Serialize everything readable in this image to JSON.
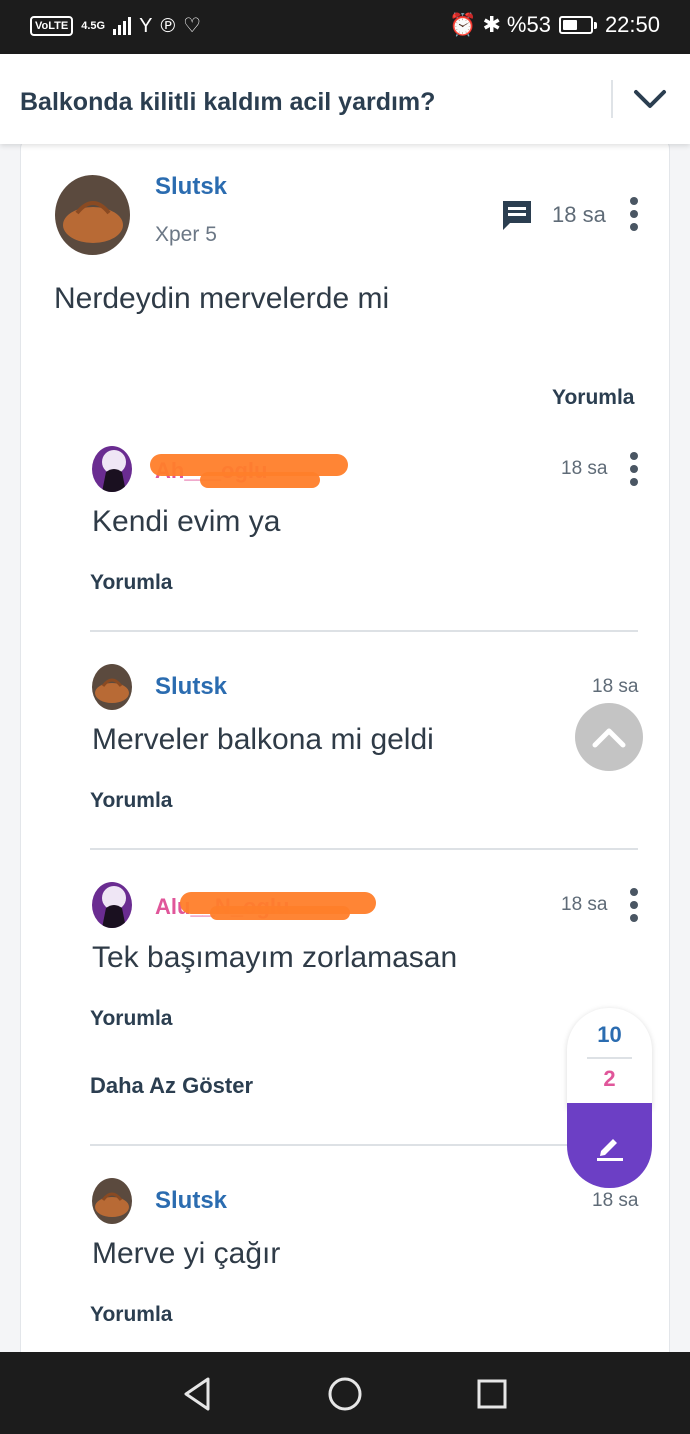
{
  "status_bar": {
    "volte": "VoLTE",
    "network": "4.5G",
    "battery_text": "%53",
    "battery_level": 0.53,
    "time": "22:50"
  },
  "header": {
    "title": "Balkonda kilitli kaldım acil yardım?"
  },
  "post": {
    "username": "Slutsk",
    "level": "Xper 5",
    "time": "18 sa",
    "text": "Nerdeydin mervelerde mi",
    "reply_label": "Yorumla"
  },
  "comments": [
    {
      "username": "Ah___oglu",
      "time": "18 sa",
      "text": "Kendi evim ya",
      "reply_label": "Yorumla"
    },
    {
      "username": "Slutsk",
      "time": "18 sa",
      "text": "Merveler balkona mi geldi",
      "reply_label": "Yorumla"
    },
    {
      "username": "Alu__N_oglu",
      "time": "18 sa",
      "text": "Tek başımayım zorlamasan",
      "reply_label": "Yorumla",
      "show_less_label": "Daha Az Göster"
    },
    {
      "username": "Slutsk",
      "time": "18 sa",
      "text": "Merve yi çağır",
      "reply_label": "Yorumla"
    }
  ],
  "votes": {
    "up": "10",
    "down": "2"
  },
  "colors": {
    "accent_blue": "#2b6cb0",
    "accent_pink": "#e0569a",
    "accent_purple": "#6c3fc5",
    "redaction_orange": "#ff7e2a"
  },
  "icons": [
    "comment-icon",
    "kebab-menu-icon",
    "chevron-down-icon",
    "chevron-up-icon",
    "pencil-icon",
    "back-icon",
    "home-icon",
    "recents-icon"
  ]
}
